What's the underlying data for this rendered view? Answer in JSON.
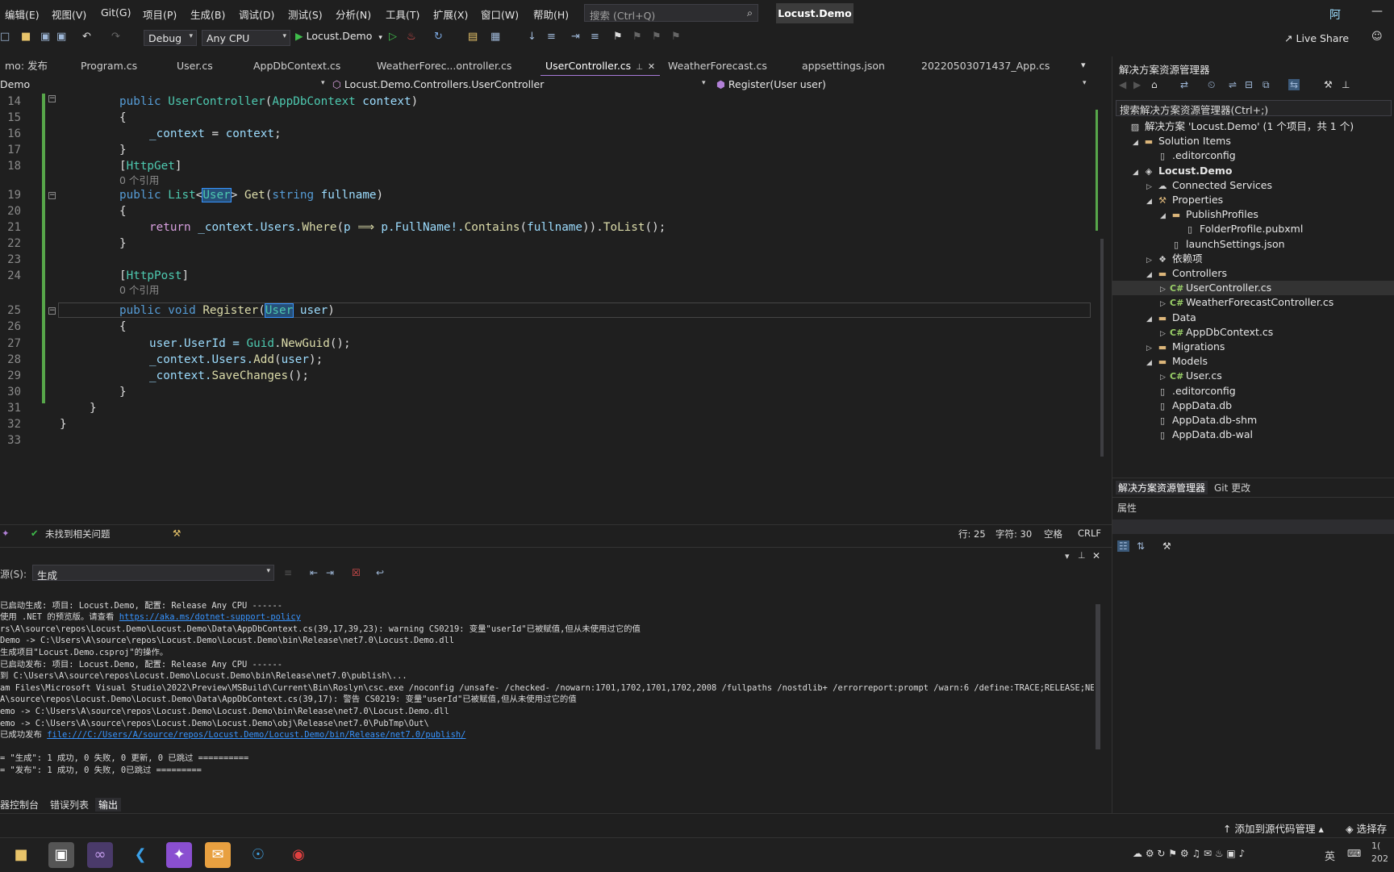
{
  "menu": [
    "编辑(E)",
    "视图(V)",
    "Git(G)",
    "项目(P)",
    "生成(B)",
    "调试(D)",
    "测试(S)",
    "分析(N)",
    "工具(T)",
    "扩展(X)",
    "窗口(W)",
    "帮助(H)"
  ],
  "search": {
    "label": "搜索 (Ctrl+Q)"
  },
  "solution_title": "Locust.Demo",
  "avatar": "阿",
  "toolbar": {
    "config": "Debug",
    "platform": "Any CPU",
    "run_target": "Locust.Demo",
    "live_share": "Live Share"
  },
  "tabs": [
    {
      "label": "mo: 发布"
    },
    {
      "label": "Program.cs"
    },
    {
      "label": "User.cs"
    },
    {
      "label": "AppDbContext.cs"
    },
    {
      "label": "WeatherForec...ontroller.cs"
    },
    {
      "label": "UserController.cs",
      "active": true
    },
    {
      "label": "WeatherForecast.cs"
    },
    {
      "label": "appsettings.json"
    },
    {
      "label": "20220503071437_App.cs"
    }
  ],
  "nav": {
    "project": "Demo",
    "class": "Locust.Demo.Controllers.UserController",
    "member": "Register(User user)"
  },
  "code": {
    "line_numbers": [
      "14",
      "15",
      "16",
      "17",
      "18",
      "19",
      "20",
      "21",
      "22",
      "23",
      "24",
      "25",
      "26",
      "27",
      "28",
      "29",
      "30",
      "31",
      "32",
      "33"
    ],
    "ref_hint": "0 个引用",
    "l14_kw": "public ",
    "l14_ty": "UserController",
    "l14_p1": "(",
    "l14_ty2": "AppDbContext",
    "l14_p2": " ",
    "l14_pm": "context",
    "l14_p3": ")",
    "brace_open": "{",
    "brace_close": "}",
    "l16_a": "_context",
    "l16_b": " = ",
    "l16_c": "context",
    "l16_d": ";",
    "l18_a": "[",
    "l18_b": "HttpGet",
    "l18_c": "]",
    "l19_a": "public ",
    "l19_b": "List",
    "l19_c": "<",
    "l19_d": "User",
    "l19_e": "> ",
    "l19_f": "Get",
    "l19_g": "(",
    "l19_h": "string ",
    "l19_i": "fullname",
    "l19_j": ")",
    "l21_a": "return ",
    "l21_b": "_context.Users.",
    "l21_c": "Where",
    "l21_d": "(",
    "l21_e": "p",
    "l21_f": " ⟹ ",
    "l21_g": "p",
    "l21_h": ".FullName!.",
    "l21_i": "Contains",
    "l21_j": "(",
    "l21_k": "fullname",
    "l21_l": ")).",
    "l21_m": "ToList",
    "l21_n": "();",
    "l24_a": "[",
    "l24_b": "HttpPost",
    "l24_c": "]",
    "l25_a": "public ",
    "l25_b": "void ",
    "l25_c": "Register",
    "l25_d": "(",
    "l25_e": "User",
    "l25_f": " ",
    "l25_g": "user",
    "l25_h": ")",
    "l27_a": "user",
    "l27_b": ".UserId = ",
    "l27_c": "Guid",
    "l27_d": ".",
    "l27_e": "NewGuid",
    "l27_f": "();",
    "l28_a": "_context.Users.",
    "l28_b": "Add",
    "l28_c": "(",
    "l28_d": "user",
    "l28_e": ");",
    "l29_a": "_context.",
    "l29_b": "SaveChanges",
    "l29_c": "();"
  },
  "editor_status": {
    "issues": "未找到相关问题",
    "line": "行: 25",
    "col": "字符: 30",
    "ws": "空格",
    "eol": "CRLF"
  },
  "output": {
    "source_label": "源(S):",
    "source_value": "生成",
    "lines": [
      "已启动生成: 项目: Locust.Demo, 配置: Release Any CPU ------",
      "使用 .NET 的预览版。请查看 ",
      "rs\\A\\source\\repos\\Locust.Demo\\Locust.Demo\\Data\\AppDbContext.cs(39,17,39,23): warning CS0219: 变量\"userId\"已被赋值,但从未使用过它的值",
      "Demo -> C:\\Users\\A\\source\\repos\\Locust.Demo\\Locust.Demo\\bin\\Release\\net7.0\\Locust.Demo.dll",
      "生成项目\"Locust.Demo.csproj\"的操作。",
      "已启动发布: 项目: Locust.Demo, 配置: Release Any CPU ------",
      "到 C:\\Users\\A\\source\\repos\\Locust.Demo\\Locust.Demo\\bin\\Release\\net7.0\\publish\\...",
      "am Files\\Microsoft Visual Studio\\2022\\Preview\\MSBuild\\Current\\Bin\\Roslyn\\csc.exe /noconfig /unsafe- /checked- /nowarn:1701,1702,1701,1702,2008 /fullpaths /nostdlib+ /errorreport:prompt /warn:6 /define:TRACE;RELEASE;NET;NET7_0;",
      "A\\source\\repos\\Locust.Demo\\Locust.Demo\\Data\\AppDbContext.cs(39,17): 警告 CS0219: 变量\"userId\"已被赋值,但从未使用过它的值",
      "emo -> C:\\Users\\A\\source\\repos\\Locust.Demo\\Locust.Demo\\bin\\Release\\net7.0\\Locust.Demo.dll",
      "emo -> C:\\Users\\A\\source\\repos\\Locust.Demo\\Locust.Demo\\obj\\Release\\net7.0\\PubTmp\\Out\\",
      "已成功发布 ",
      "",
      "= \"生成\": 1 成功, 0 失败, 0 更新, 0 已跳过 ==========",
      "= \"发布\": 1 成功, 0 失败, 0已跳过 ========="
    ],
    "link1": "https://aka.ms/dotnet-support-policy",
    "link2": "file:///C:/Users/A/source/repos/Locust.Demo/Locust.Demo/bin/Release/net7.0/publish/"
  },
  "bottom_tabs": [
    "器控制台",
    "错误列表",
    "输出"
  ],
  "solution_explorer": {
    "title": "解决方案资源管理器",
    "search_placeholder": "搜索解决方案资源管理器(Ctrl+;)",
    "items": [
      {
        "label": "解决方案 'Locust.Demo' (1 个项目，共 1 个)",
        "icon": "solution-icon",
        "depth": 0
      },
      {
        "label": "Solution Items",
        "icon": "folder-icon",
        "depth": 1,
        "exp": "open"
      },
      {
        "label": ".editorconfig",
        "icon": "file-icon",
        "depth": 2
      },
      {
        "label": "Locust.Demo",
        "icon": "project-icon",
        "depth": 1,
        "exp": "open",
        "bold": true
      },
      {
        "label": "Connected Services",
        "icon": "connected-services-icon",
        "depth": 2,
        "exp": "closed"
      },
      {
        "label": "Properties",
        "icon": "properties-icon",
        "depth": 2,
        "exp": "open"
      },
      {
        "label": "PublishProfiles",
        "icon": "folder-icon",
        "depth": 3,
        "exp": "open"
      },
      {
        "label": "FolderProfile.pubxml",
        "icon": "file-icon",
        "depth": 4
      },
      {
        "label": "launchSettings.json",
        "icon": "file-icon",
        "depth": 3
      },
      {
        "label": "依赖项",
        "icon": "dependencies-icon",
        "depth": 2,
        "exp": "closed"
      },
      {
        "label": "Controllers",
        "icon": "folder-icon",
        "depth": 2,
        "exp": "open"
      },
      {
        "label": "UserController.cs",
        "icon": "csharp-file-icon",
        "depth": 3,
        "exp": "closed",
        "selected": true
      },
      {
        "label": "WeatherForecastController.cs",
        "icon": "csharp-file-icon",
        "depth": 3,
        "exp": "closed"
      },
      {
        "label": "Data",
        "icon": "folder-icon",
        "depth": 2,
        "exp": "open"
      },
      {
        "label": "AppDbContext.cs",
        "icon": "csharp-file-icon",
        "depth": 3,
        "exp": "closed"
      },
      {
        "label": "Migrations",
        "icon": "folder-icon",
        "depth": 2,
        "exp": "closed"
      },
      {
        "label": "Models",
        "icon": "folder-icon",
        "depth": 2,
        "exp": "open"
      },
      {
        "label": "User.cs",
        "icon": "csharp-file-icon",
        "depth": 3,
        "exp": "closed"
      },
      {
        "label": ".editorconfig",
        "icon": "file-icon",
        "depth": 2
      },
      {
        "label": "AppData.db",
        "icon": "file-icon",
        "depth": 2
      },
      {
        "label": "AppData.db-shm",
        "icon": "file-icon",
        "depth": 2
      },
      {
        "label": "AppData.db-wal",
        "icon": "file-icon",
        "depth": 2
      }
    ],
    "tab_explorer": "解决方案资源管理器",
    "tab_git": "Git 更改",
    "properties_title": "属性"
  },
  "statusbar": {
    "source_control": "添加到源代码管理",
    "select_repo": "选择存"
  },
  "tray": {
    "ime": "英",
    "clock_a": "1(",
    "clock_b": "202"
  },
  "colors": {
    "keyword": "#569cd6",
    "type": "#4ec9b0",
    "method": "#dcdcaa",
    "param": "#9cdcfe",
    "accent_tab": "#a77ad8",
    "green_change": "#57a64a",
    "link": "#3794ff"
  }
}
